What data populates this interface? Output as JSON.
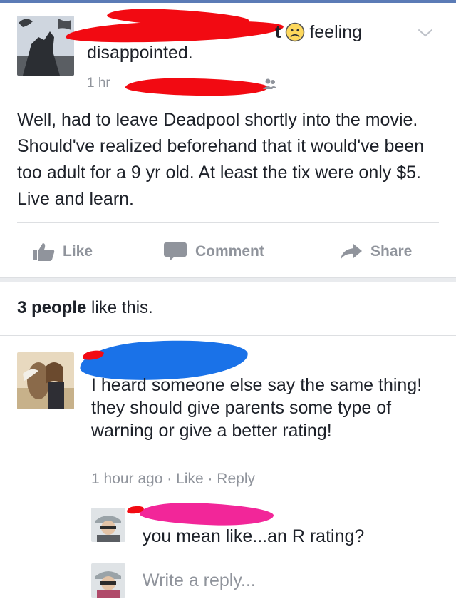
{
  "post": {
    "header_fragment": "t",
    "feeling_label": "feeling",
    "feeling": "disappointed.",
    "time": "1 hr",
    "body": "Well, had to leave Deadpool shortly into the movie. Should've realized beforehand that it would've been too adult for a 9 yr old. At least the tix were only $5. Live and learn.",
    "icons": {
      "feeling": "sad-face-icon",
      "options": "chevron-down-icon",
      "privacy": "friends-icon"
    }
  },
  "actions": {
    "like": "Like",
    "comment": "Comment",
    "share": "Share",
    "icons": [
      "thumbs-up-icon",
      "comment-bubble-icon",
      "share-arrow-icon"
    ]
  },
  "likes": {
    "count_text": "3 people",
    "suffix": " like this."
  },
  "comment": {
    "text": "I heard someone else say the same thing!  they should give parents some type of warning or give a better rating!",
    "time": "1 hour ago",
    "separator": " · ",
    "like_label": "Like",
    "reply_label": "Reply"
  },
  "reply": {
    "text": "you mean like...an R rating?"
  },
  "reply_input": {
    "placeholder": "Write a reply..."
  },
  "colors": {
    "meta_gray": "#90949c",
    "text": "#1d2129",
    "redact_red": "#f20a12",
    "redact_blue": "#1a72e8",
    "redact_pink": "#f22699",
    "divider": "#dddfe2"
  }
}
